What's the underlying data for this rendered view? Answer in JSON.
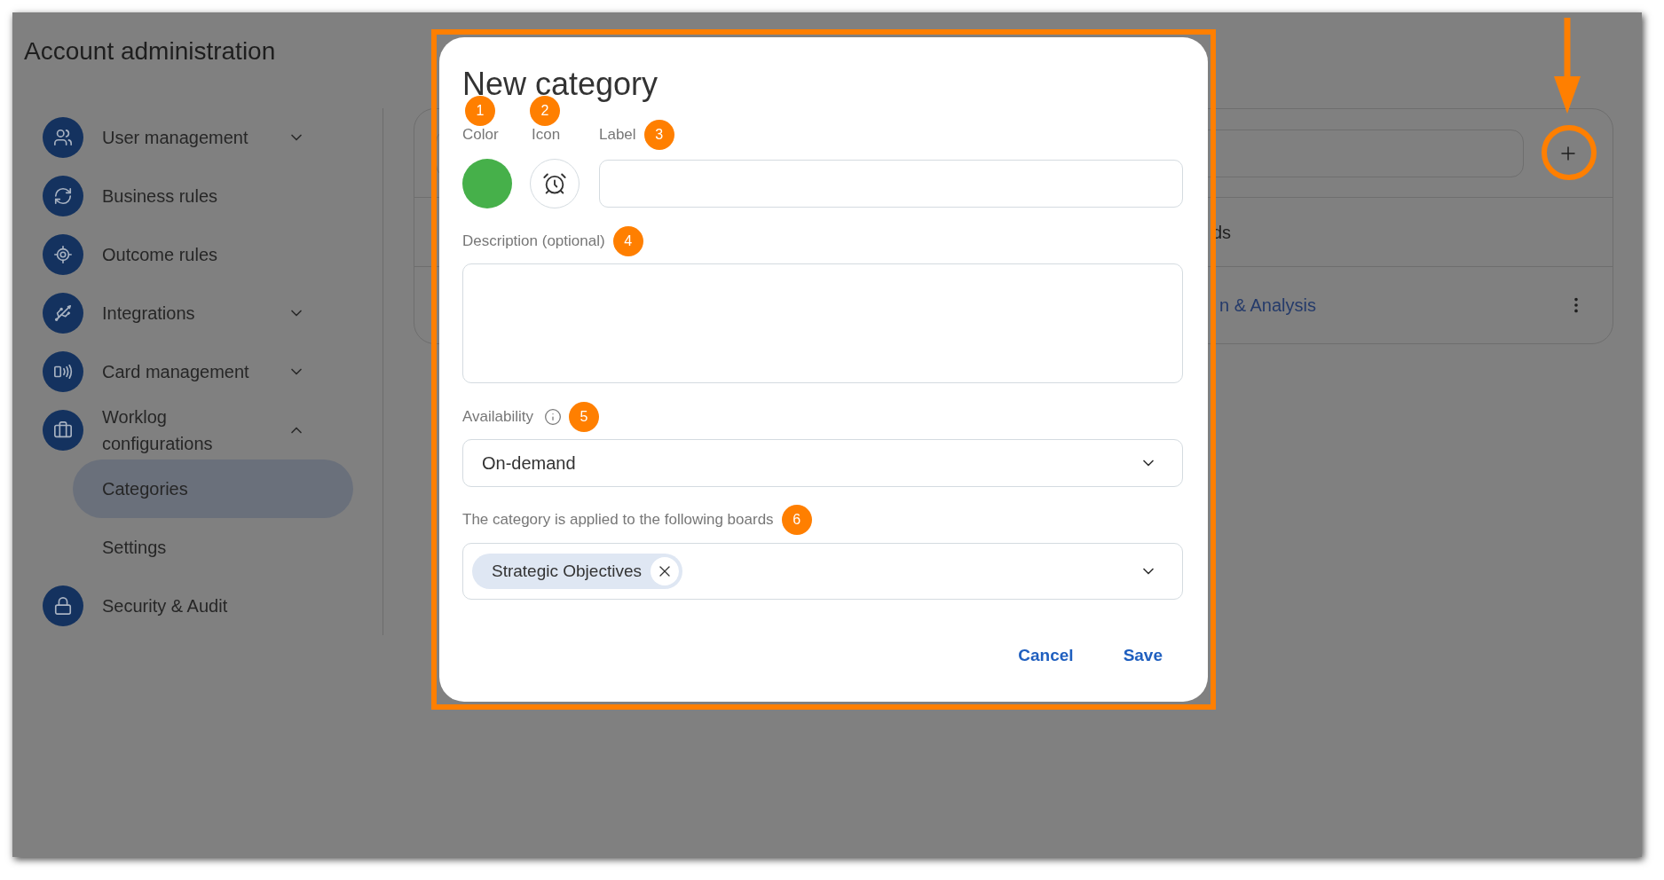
{
  "window": {
    "title": "Account administration"
  },
  "sidebar": {
    "items": [
      {
        "label": "User management",
        "kind": "group",
        "expanded": false,
        "selected": false
      },
      {
        "label": "Business rules",
        "kind": "link",
        "selected": false
      },
      {
        "label": "Outcome rules",
        "kind": "link",
        "selected": false
      },
      {
        "label": "Integrations",
        "kind": "group",
        "expanded": false,
        "selected": false
      },
      {
        "label": "Card management",
        "kind": "group",
        "expanded": false,
        "selected": false
      },
      {
        "label": "Worklog configurations",
        "kind": "group",
        "expanded": true,
        "selected": false,
        "children": [
          {
            "label": "Categories",
            "selected": true
          },
          {
            "label": "Settings",
            "selected": false
          }
        ]
      },
      {
        "label": "Security & Audit",
        "kind": "link",
        "selected": false
      }
    ]
  },
  "background_card": {
    "header": "ds",
    "rows": [
      {
        "label": "n & Analysis"
      }
    ]
  },
  "dialog": {
    "title": "New category",
    "color": {
      "label": "Color",
      "callout": "1",
      "color": "#46b04a"
    },
    "icon": {
      "label": "Icon",
      "callout": "2"
    },
    "label_field": {
      "label": "Label",
      "callout": "3"
    },
    "description": {
      "label": "Description (optional)",
      "callout": "4"
    },
    "availability": {
      "label": "Availability",
      "callout": "5",
      "value": "On-demand"
    },
    "boards": {
      "label": "The category is applied to the following boards",
      "callout": "6",
      "chips": [
        "Strategic Objectives"
      ]
    },
    "buttons": [
      "Cancel",
      "Save"
    ]
  }
}
